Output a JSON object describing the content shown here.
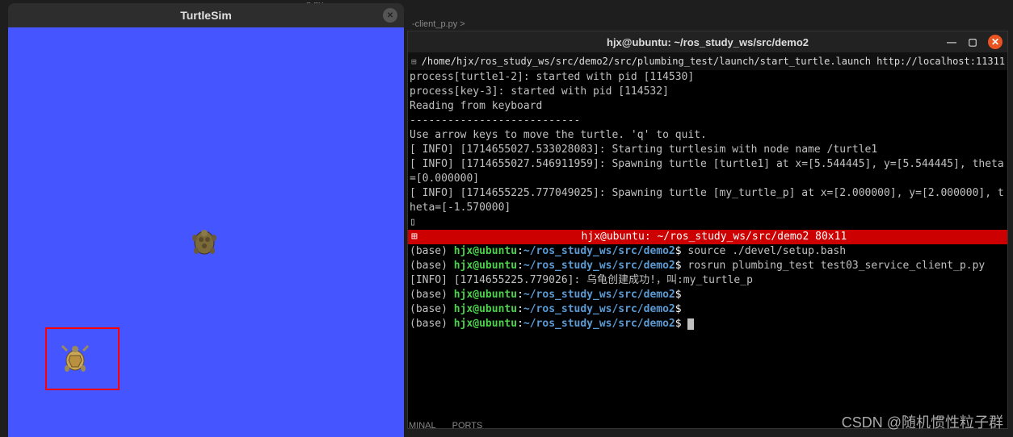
{
  "turtlesim": {
    "title": "TurtleSim",
    "close_glyph": "✕"
  },
  "bg_tab1": "...p.py",
  "bg_tab2": "-client_p.py >",
  "terminal": {
    "title": "hjx@ubuntu: ~/ros_study_ws/src/demo2",
    "min_glyph": "—",
    "max_glyph": "▢",
    "close_glyph": "✕",
    "tab_icon": "⊞",
    "tab_path": "/home/hjx/ros_study_ws/src/demo2/src/plumbing_test/launch/start_turtle.launch http://localhost:11311",
    "pane1": [
      "process[turtle1-2]: started with pid [114530]",
      "process[key-3]: started with pid [114532]",
      "Reading from keyboard",
      "---------------------------",
      "Use arrow keys to move the turtle. 'q' to quit.",
      "[ INFO] [1714655027.533028083]: Starting turtlesim with node name /turtle1",
      "[ INFO] [1714655027.546911959]: Spawning turtle [turtle1] at x=[5.544445], y=[5.544445], theta=[0.000000]",
      "[ INFO] [1714655225.777049025]: Spawning turtle [my_turtle_p] at x=[2.000000], y=[2.000000], theta=[-1.570000]",
      "▯"
    ],
    "divider": {
      "icon": "⊞",
      "text": "hjx@ubuntu: ~/ros_study_ws/src/demo2 80x11"
    },
    "prompt": {
      "base": "(base) ",
      "user": "hjx@ubuntu",
      "colon": ":",
      "path": "~/ros_study_ws/src/demo2",
      "dollar": "$"
    },
    "pane2_lines": [
      {
        "cmd": " source ./devel/setup.bash"
      },
      {
        "cmd": " rosrun plumbing_test test03_service_client_p.py",
        "wrap": true
      },
      {
        "plain": ""
      },
      {
        "plain": "[INFO] [1714655225.779026]: 乌龟创建成功!，叫:my_turtle_p"
      },
      {
        "cmd": ""
      },
      {
        "cmd": ""
      },
      {
        "cmd": " ",
        "cursor": true
      }
    ]
  },
  "bottom_tabs": {
    "terminal": "MINAL",
    "ports": "PORTS"
  },
  "watermark": "CSDN @随机惯性粒子群"
}
